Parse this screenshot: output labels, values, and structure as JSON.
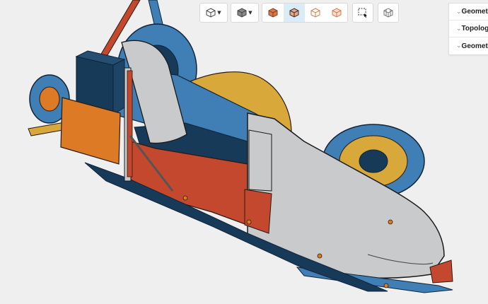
{
  "toolbar": {
    "buttons": [
      {
        "icon": "view-cube-icon",
        "has_dropdown": true,
        "active": false
      },
      {
        "icon": "shading-mode-icon",
        "has_dropdown": true,
        "active": false
      },
      {
        "icon": "solid-faces-icon",
        "has_dropdown": false,
        "active": false
      },
      {
        "icon": "solid-edges-icon",
        "has_dropdown": false,
        "active": true
      },
      {
        "icon": "wireframe-icon",
        "has_dropdown": false,
        "active": false
      },
      {
        "icon": "transparent-icon",
        "has_dropdown": false,
        "active": false
      },
      {
        "icon": "box-select-icon",
        "has_dropdown": false,
        "active": false
      },
      {
        "icon": "mesh-cube-icon",
        "has_dropdown": false,
        "active": false
      }
    ],
    "dropdown_caret": "▼"
  },
  "panel": {
    "items": [
      {
        "label": "Geometry",
        "chevron": "⌄"
      },
      {
        "label": "Topology",
        "chevron": "⌄"
      },
      {
        "label": "Geometry",
        "chevron": "⌄"
      }
    ]
  },
  "colors": {
    "background": "#efefef",
    "body_grey": "#c8cacc",
    "blue": "#3f7fb5",
    "navy": "#163a58",
    "red": "#c4482e",
    "orange": "#dd7a25",
    "yellow": "#d8a93a",
    "accent": "#dcecf7"
  }
}
